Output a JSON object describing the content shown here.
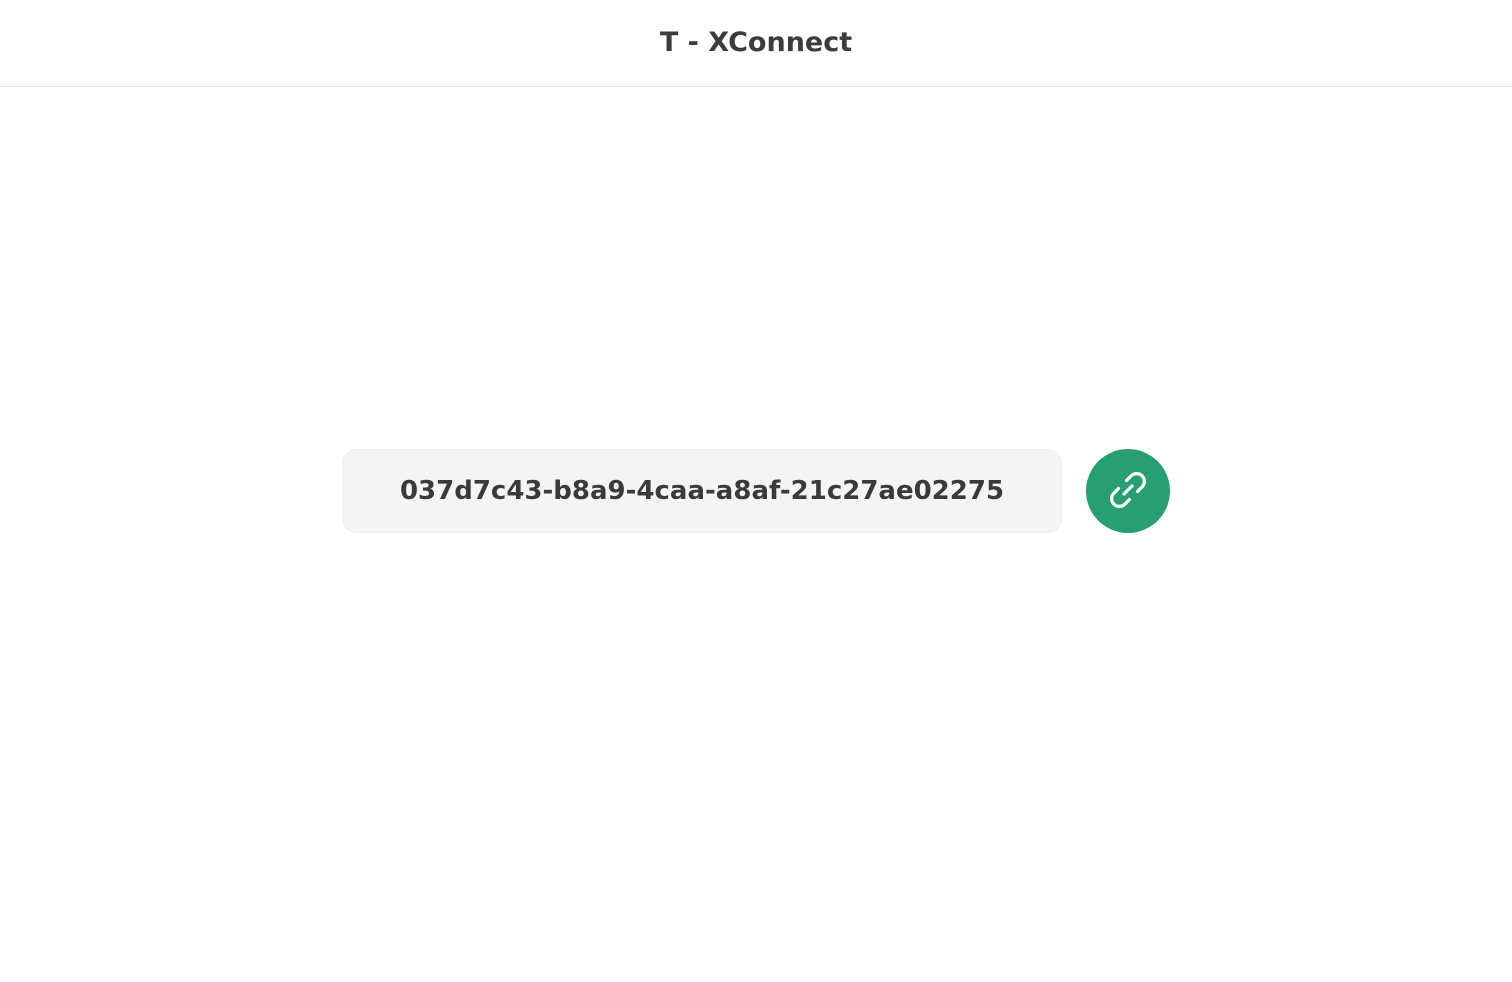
{
  "header": {
    "title": "T - XConnect"
  },
  "connect": {
    "id_value": "037d7c43-b8a9-4caa-a8af-21c27ae02275",
    "button_icon": "link-icon"
  },
  "colors": {
    "accent": "#279f72",
    "field_background": "#f4f4f4",
    "text": "#3a3a3a",
    "header_border": "#e2e2e2"
  }
}
